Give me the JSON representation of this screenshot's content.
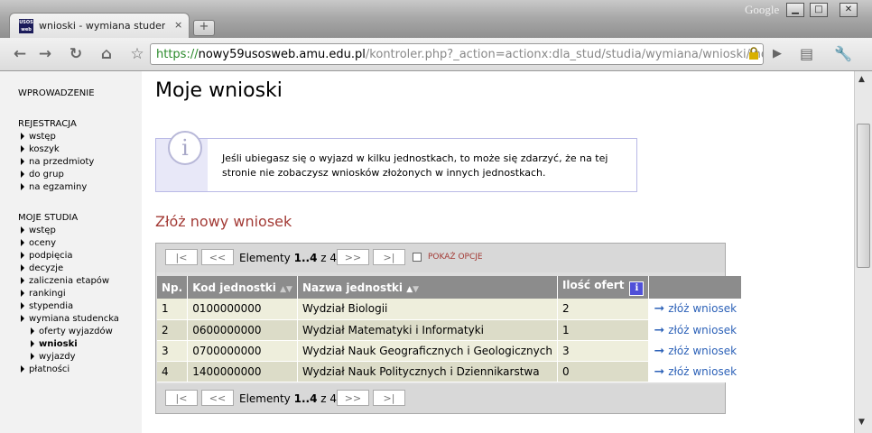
{
  "browser": {
    "tab_title": "wnioski - wymiana studenc...",
    "favicon_text": "USOS web",
    "tab_close": "×",
    "new_tab": "+",
    "brand": "Google",
    "window_buttons": {
      "minimize": "▁",
      "maximize": "□",
      "close": "✕"
    },
    "url_secure": "https://",
    "url_host": "nowy59usosweb.amu.edu.pl",
    "url_path": "/kontroler.php?_action=actionx:dla_stud/studia/wymiana/wnioski/inde",
    "nav": {
      "back": "←",
      "forward": "→",
      "reload": "↻",
      "home": "⌂",
      "star": "☆",
      "go": "▶",
      "page_menu": "▤",
      "tools_menu": "🔧"
    }
  },
  "sidebar": {
    "wprowadzenie": "WPROWADZENIE",
    "rejestracja": {
      "title": "REJESTRACJA",
      "items": [
        "wstęp",
        "koszyk",
        "na przedmioty",
        "do grup",
        "na egzaminy"
      ]
    },
    "moje_studia": {
      "title": "MOJE STUDIA",
      "items": [
        "wstęp",
        "oceny",
        "podpięcia",
        "decyzje",
        "zaliczenia etapów",
        "rankingi",
        "stypendia",
        "wymiana studencka"
      ],
      "subitems": [
        "oferty wyjazdów",
        "wnioski",
        "wyjazdy"
      ],
      "after": [
        "płatności"
      ]
    }
  },
  "main": {
    "title": "Moje wnioski",
    "info_icon": "i",
    "info_text": "Jeśli ubiegasz się o wyjazd w kilku jednostkach, to może się zdarzyć, że na tej stronie nie zobaczysz wniosków złożonych w innych jednostkach.",
    "subtitle": "Złóż nowy wniosek",
    "pager": {
      "first": "|<",
      "prev": "<<",
      "next": ">>",
      "last": ">|",
      "label": "Elementy",
      "range": "1..4",
      "of": "z 4",
      "options": "POKAŻ OPCJE"
    },
    "table": {
      "headers": [
        "Np.",
        "Kod jednostki",
        "Nazwa jednostki",
        "Ilość ofert",
        ""
      ],
      "sort_up": "▲",
      "sort_down": "▼",
      "header_info_icon": "i",
      "rows": [
        {
          "np": "1",
          "kod": "0100000000",
          "nazwa": "Wydział Biologii",
          "ilosc": "2",
          "akcja": "złóż wniosek"
        },
        {
          "np": "2",
          "kod": "0600000000",
          "nazwa": "Wydział Matematyki i Informatyki",
          "ilosc": "1",
          "akcja": "złóż wniosek"
        },
        {
          "np": "3",
          "kod": "0700000000",
          "nazwa": "Wydział Nauk Geograficznych i Geologicznych",
          "ilosc": "3",
          "akcja": "złóż wniosek"
        },
        {
          "np": "4",
          "kod": "1400000000",
          "nazwa": "Wydział Nauk Politycznych i Dziennikarstwa",
          "ilosc": "0",
          "akcja": "złóż wniosek"
        }
      ]
    }
  },
  "colors": {
    "accent_red": "#a33b36",
    "link_blue": "#2d62b8",
    "header_gray": "#8c8c8c"
  }
}
